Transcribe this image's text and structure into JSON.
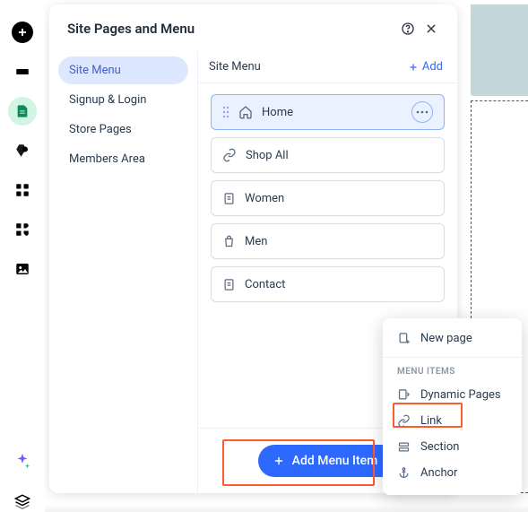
{
  "panel": {
    "title": "Site Pages and Menu"
  },
  "sidebar": {
    "items": [
      {
        "label": "Site Menu",
        "selected": true
      },
      {
        "label": "Signup & Login",
        "selected": false
      },
      {
        "label": "Store Pages",
        "selected": false
      },
      {
        "label": "Members Area",
        "selected": false
      }
    ]
  },
  "main": {
    "header_title": "Site Menu",
    "add_label": "Add",
    "items": [
      {
        "icon": "home",
        "label": "Home",
        "selected": true
      },
      {
        "icon": "link",
        "label": "Shop All",
        "selected": false
      },
      {
        "icon": "page",
        "label": "Women",
        "selected": false
      },
      {
        "icon": "bag",
        "label": "Men",
        "selected": false
      },
      {
        "icon": "page",
        "label": "Contact",
        "selected": false
      }
    ],
    "add_menu_item_label": "Add Menu Item"
  },
  "dropdown": {
    "new_page_label": "New page",
    "heading": "MENU ITEMS",
    "items": [
      {
        "icon": "dynamic",
        "label": "Dynamic Pages"
      },
      {
        "icon": "link",
        "label": "Link"
      },
      {
        "icon": "section",
        "label": "Section"
      },
      {
        "icon": "anchor",
        "label": "Anchor"
      }
    ]
  }
}
